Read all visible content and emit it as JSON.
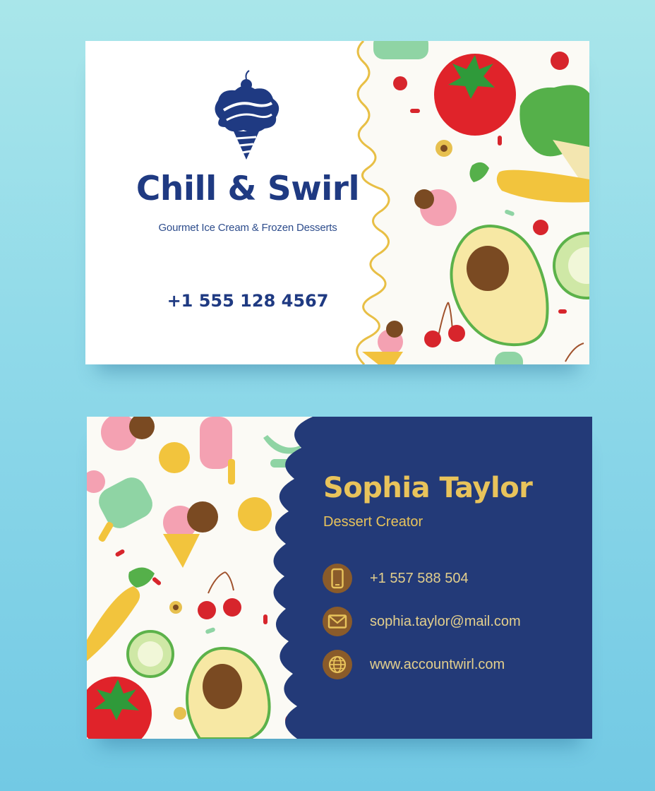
{
  "front": {
    "brand": "Chill & Swirl",
    "tagline": "Gourmet Ice Cream & Frozen Desserts",
    "phone": "+1 555 128 4567",
    "logo_icon": "ice-cream-cone-icon"
  },
  "back": {
    "name": "Sophia Taylor",
    "role": "Dessert Creator",
    "contacts": [
      {
        "icon": "phone-icon",
        "text": "+1 557 588 504"
      },
      {
        "icon": "mail-icon",
        "text": "sophia.taylor@mail.com"
      },
      {
        "icon": "globe-icon",
        "text": "www.accountwirl.com"
      }
    ]
  },
  "colors": {
    "navy": "#1f3a82",
    "gold": "#e8c35b",
    "background": "#8fd9e9",
    "icon_circle": "#8a5b2a"
  }
}
